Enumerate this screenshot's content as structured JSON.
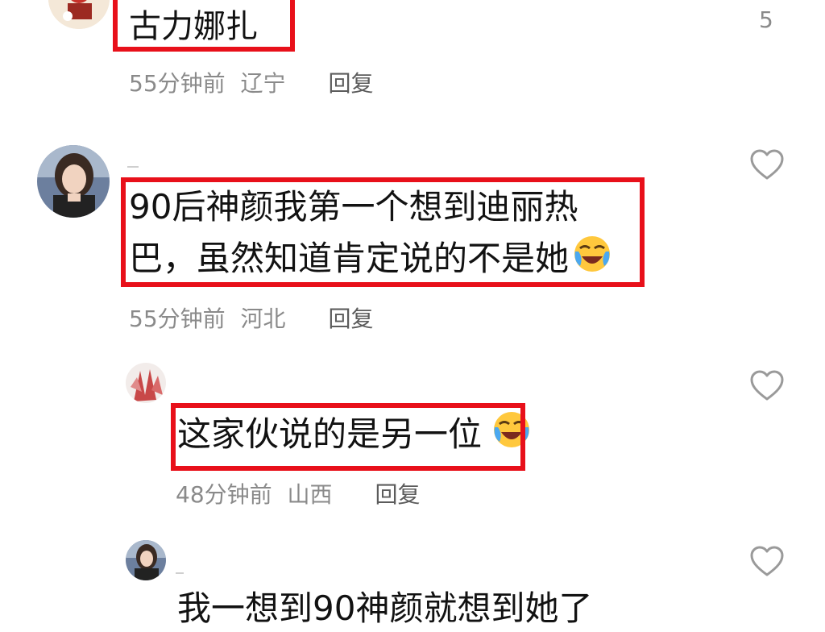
{
  "comments": [
    {
      "text": "古力娜扎",
      "likes": "5",
      "time": "55分钟前",
      "location": "辽宁",
      "reply": "回复"
    },
    {
      "text_line1": "90后神颜我第一个想到迪丽热",
      "text_line2": "巴，虽然知道肯定说的不是她",
      "time": "55分钟前",
      "location": "河北",
      "reply": "回复"
    },
    {
      "text": "这家伙说的是另一位",
      "time": "48分钟前",
      "location": "山西",
      "reply": "回复"
    },
    {
      "text": "我一想到90神颜就想到她了"
    }
  ],
  "colors": {
    "highlight_border": "#e8101a",
    "meta_text": "#8a8a8a",
    "reply_text": "#5c5c5c",
    "icon_stroke": "#9a9a9a"
  }
}
